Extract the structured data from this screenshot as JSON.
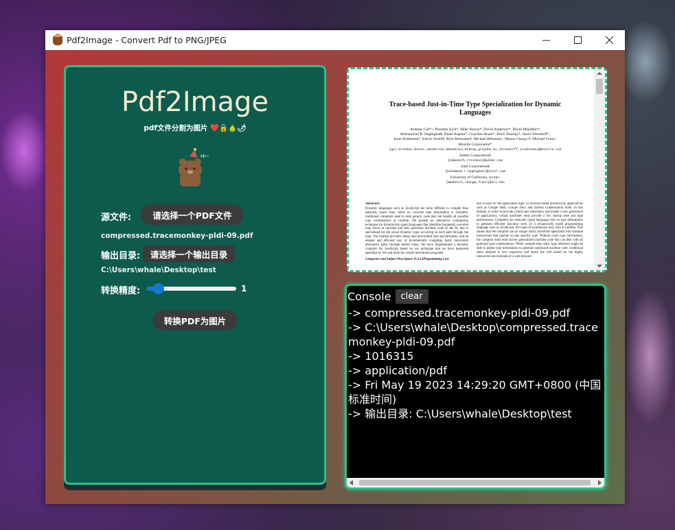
{
  "window": {
    "title": "Pdf2Image - Convert Pdf to PNG/JPEG",
    "controls": {
      "minimize": "—",
      "maximize": "☐",
      "close": "✕"
    }
  },
  "app": {
    "title": "Pdf2Image",
    "subtitle": "pdf文件分割为图片 ❤️🔒🍐🌶"
  },
  "form": {
    "source_label": "源文件:",
    "source_button": "请选择一个PDF文件",
    "source_value": "compressed.tracemonkey-pldi-09.pdf",
    "output_label": "输出目录:",
    "output_button": "请选择一个输出目录",
    "output_value": "C:\\Users\\whale\\Desktop\\test",
    "precision_label": "转换精度:",
    "precision_value": "1",
    "precision_fraction": 0.08,
    "convert_button": "转换PDF为图片"
  },
  "preview": {
    "title_line1": "Trace-based Just-in-Time Type Specialization for Dynamic",
    "title_line2": "Languages",
    "authors1": "Andreas Gal*+, Brendan Eich*, Mike Shaver*, David Anderson*, David Mandelin*,",
    "authors2": "Mohammad R. Haghighat$, Blake Kaplan*, Graydon Hoare*, Boris Zbarsky*, Jason Orendorff*,",
    "authors3": "Jesse Ruderman*, Edwin Smith#, Rick Reitmaier#, Michael Bebenita+, Mason Chang+#, Michael Franz+",
    "aff1": "Mozilla Corporation*",
    "email1": "{gal,brendan,shaver,danderson,dmandelin,mrbkap,graydon,bz,jorendorff,jruderman}@mozilla.com",
    "aff2": "Adobe Corporation#",
    "email2": "{edwsmith,rreitmai}@adobe.com",
    "aff3": "Intel Corporation$",
    "email3": "{mohammad.r.haghighat}@intel.com",
    "aff4": "University of California, Irvine+",
    "email4": "{mbebenit,changm,franz}@uci.edu",
    "abstract_heading": "Abstract",
    "abstract_text": "Dynamic languages such as JavaScript are more difficult to compile than statically typed ones. Since no concrete type information is available, traditional compilers need to emit generic code that can handle all possible type combinations at runtime. We present an alternative compilation technique for dynamically-typed languages that identifies frequently executed loop traces at run-time and then generates machine code on the fly that is specialized for the actual dynamic types occurring on each path through the loop. Our method provides cheap inter-procedural type specialization, and an elegant and efficient way of incrementally compiling lazily discovered alternative paths through nested loops. We have implemented a dynamic compiler for JavaScript based on our technique and we have measured speedups of 10x and more for certain benchmark programs.",
    "categories_text": "Categories and Subject Descriptors   D.3.4 [Programming Lan-",
    "right_col_text": "and is used for the application logic of browser-based productivity applications such as Google Mail, Google Docs and Zimbra Collaboration Suite. In this domain, in order to provide a fluid user experience and enable a new generation of applications, virtual machines must provide a low startup time and high performance. Compilers for statically typed languages rely on type information to generate efficient machine code. In a dynamically typed programming language such as JavaScript, the types of expressions may vary at runtime. This means that the compiler can no longer easily transform operations into machine instructions that operate on one specific type. Without exact type information, the compiler must emit slower generalized machine code that can deal with all potential type combinations. While compile-time static type inference might be able to gather type information to generate optimized machine code, traditional static analysis is very expensive and hence not well suited for the highly interactive environment of a web browser."
  },
  "console": {
    "title": "Console",
    "clear_label": "clear",
    "lines": [
      "-> compressed.tracemonkey-pldi-09.pdf",
      "-> C:\\Users\\whale\\Desktop\\compressed.tracemonkey-pldi-09.pdf",
      "-> 1016315",
      "-> application/pdf",
      "-> Fri May 19 2023 14:29:20 GMT+0800 (中国标准时间)",
      "-> 输出目录: C:\\Users\\whale\\Desktop\\test"
    ]
  },
  "colors": {
    "panel_bg": "#0d5b4d",
    "accent_border": "#2bc08a",
    "button_bg": "#3b3b3b",
    "slider_blue": "#1976d2"
  }
}
